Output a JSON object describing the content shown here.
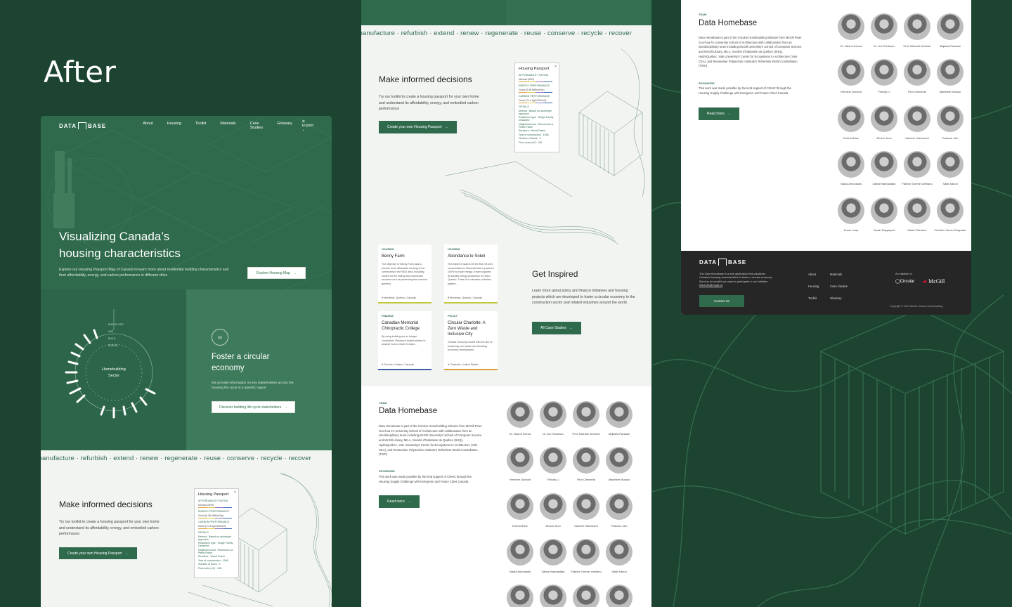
{
  "heading": "After",
  "nav": {
    "logo_left": "DATA",
    "logo_right": "BASE",
    "links": [
      "About",
      "Housing",
      "Toolkit",
      "Materials",
      "Case Studies",
      "Glossary"
    ],
    "language": "English"
  },
  "hero": {
    "title_line1": "Visualizing Canada’s",
    "title_line2": "housing characteristics",
    "subtitle": "Explore our Housing Passport Map of Canada to learn more about residential building characteristics and their affordability, energy, and carbon performance in different cities",
    "button": "Explore Housing Map"
  },
  "homebuilding": {
    "label_line1": "Homebuilding",
    "label_line2": "Sector",
    "ring_labels": [
      "END OF LIFE",
      "USE",
      "BUILD",
      "DESIGN"
    ]
  },
  "foster": {
    "title_line1": "Foster a circular",
    "title_line2": "economy",
    "subtitle": "We provide information on key stakeholders across the housing life cycle in a specific region",
    "button": "Discover building life cycle stakeholders"
  },
  "ticker": "manufacture · refurbish · extend · renew · regenerate · reuse · conserve · recycle · recover",
  "informed": {
    "title": "Make informed decisions",
    "subtitle": "Try our toolkit to create a housing passport for your own home and understand its affordability, energy, and embodied carbon performance",
    "button": "Create your own Housing Passport"
  },
  "passport": {
    "title": "Housing Passport",
    "sections": [
      {
        "label": "AFFORDABILITY RATING",
        "value": "Normal (42%)"
      },
      {
        "label": "ENERGY PERFORMANCE",
        "value": "Good (0.36 kWh/m²/yr)"
      },
      {
        "label": "CARBON PERFORMANCE",
        "value": "Good (71.4 kgCO2e/m2)"
      }
    ],
    "details_label": "DETAILS",
    "details": [
      "Method : Based on archetype approach",
      "Residence type : Single Family Detached",
      "Neighbourhood : Rosemont-La Petite-Patrie",
      "Structure : Wood Frame",
      "Year of construction : 1946",
      "Number of floors : 2",
      "Floor area (m²) : 138"
    ]
  },
  "cards": [
    {
      "category": "HOUSING",
      "title": "Benny Farm",
      "desc": "The objective of Benny Farm was to provide more affordable housing to the community in the NDG area, including homes for the elderly and community services such as preserving the common gardens.",
      "location": "Montreal, Quebec, Canada",
      "color": "#c2c83e"
    },
    {
      "category": "HOUSING",
      "title": "Abondance le Soleil",
      "desc": "This triplex is said to be the first net zero condominium in Montreal that is powered 100% by solar energy. It even supplies its surplus energy production to Hydro-Quebec. There is a rainwater collection system...",
      "location": "Montreal, Quebec, Canada",
      "color": "#c2c83e"
    },
    {
      "category": "FINANCE",
      "title": "Canadian Memorial Chiropractic College",
      "desc": "By using building due to budget constraints. Research project started to analyze how to retain 5 major...",
      "location": "Toronto, Ontario, Canada",
      "color": "#3c5fa8"
    },
    {
      "category": "POLICY",
      "title": "Circular Charlotte: A Zero Waste and Inclusive City",
      "desc": "Circular Economy model with the aim of producing zero waste and boosting economic development.",
      "location": "Charlotte, United States",
      "color": "#e29b3b"
    }
  ],
  "inspired": {
    "title": "Get Inspired",
    "subtitle": "Learn more about policy and finance initiatives and housing projects which are developed to foster a circular economy in the construction sector and related industries around the world.",
    "button": "All Case Studies"
  },
  "team": {
    "label": "TEAM",
    "title": "Data Homebase",
    "body": "Data Homebase is part of the Circular Homebuilding initiative from McGill Peter Guo-hua Fu University School of Architecture with collaboration from an interdisciplinary team including McGill University's School of Computer Science and McGill Library, MILA, Société d'habitation du Québec (SHQ), HydroQuébec, Yale University's Center for Ecosystems in Architecture (Yale CEA), and Rensselaer Polytechnic Institute's Tetherless World Constellation (TWC).",
    "sponsors_label": "SPONSORS",
    "sponsors_body": "This work was made possible by the kind support of CMHC through the Housing Supply Challenge with Evergreen and Future Cities Canada.",
    "button": "Read more",
    "members": [
      "Dr. Naomi Keena",
      "Dr. Avi Friedman",
      "Prof. Michael Jemtrud",
      "Mojtaba Parsaee",
      "Hermine Dumont",
      "Felicity Li",
      "Finn Clements",
      "Madeline Musolo",
      "Emma Brice",
      "Jihoon Jeon",
      "Kareem Hammami",
      "Prasoon Jain",
      "Nadia Antoniadis",
      "Liliane Bamdadian",
      "Fabrice Grenier Arellano",
      "Sahil Adhuri",
      "Annie Lowy",
      "Jonah Rappaport",
      "Maria Telenaux",
      "Frédéric Verner-Paquette"
    ]
  },
  "footer": {
    "desc": "The Data Homebase is a web application that visualizes Canada's housing characteristics to foster a circular economy. Send us an email if you want to participate in our initiative:",
    "email": "trans.lab@mcgill.ca",
    "links_col1": [
      "About",
      "Housing",
      "Toolkit"
    ],
    "links_col2": [
      "Materials",
      "Case Studies",
      "Glossary"
    ],
    "initiative": "An initiative of",
    "partner1": "Circular",
    "partner2": "McGill",
    "contact": "Contact Us",
    "copyright": "Copyright © 2021 McGill Circular Homebuilding"
  }
}
